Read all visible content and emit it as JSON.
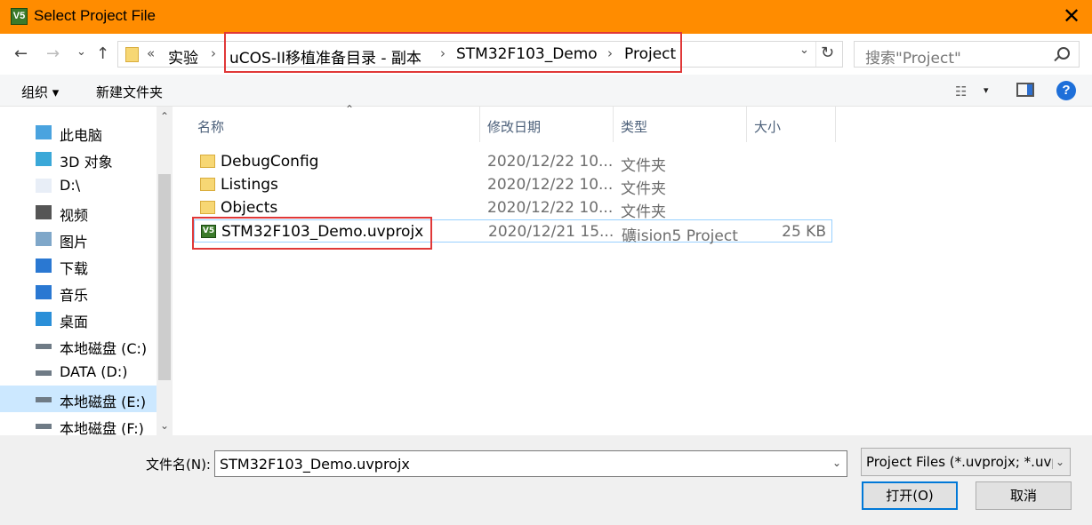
{
  "window": {
    "title": "Select Project File",
    "close_glyph": "✕",
    "app_icon_text": "V5"
  },
  "nav": {
    "back_glyph": "←",
    "forward_glyph": "→",
    "recent_glyph": "⌄",
    "up_glyph": "↑",
    "overflow_glyph": "«",
    "breadcrumbs": [
      "实验",
      "uCOS-II移植准备目录 - 副本",
      "STM32F103_Demo",
      "Project"
    ],
    "sep_glyph": "›",
    "dropdown_glyph": "⌄",
    "refresh_glyph": "↻",
    "search_placeholder": "搜索\"Project\""
  },
  "toolbar": {
    "organize_label": "组织 ▾",
    "new_folder_label": "新建文件夹",
    "view_glyph": "☷",
    "view_drop_glyph": "▾",
    "help_glyph": "?"
  },
  "sidebar": {
    "items": [
      {
        "label": "此电脑",
        "icon": "computer-icon",
        "color": "#4aa3df"
      },
      {
        "label": "3D 对象",
        "icon": "cube-icon",
        "color": "#3aa8d8"
      },
      {
        "label": "D:\\",
        "icon": "document-icon",
        "color": "#e8eef7"
      },
      {
        "label": "视频",
        "icon": "film-icon",
        "color": "#555555"
      },
      {
        "label": "图片",
        "icon": "picture-icon",
        "color": "#7fa7c9"
      },
      {
        "label": "下载",
        "icon": "download-icon",
        "color": "#2a78d2"
      },
      {
        "label": "音乐",
        "icon": "music-icon",
        "color": "#2a78d2"
      },
      {
        "label": "桌面",
        "icon": "desktop-icon",
        "color": "#2a8fd8"
      },
      {
        "label": "本地磁盘 (C:)",
        "icon": "drive-c-icon",
        "color": "#6f7b86"
      },
      {
        "label": "DATA (D:)",
        "icon": "drive-icon",
        "color": "#6f7b86"
      },
      {
        "label": "本地磁盘 (E:)",
        "icon": "drive-icon",
        "color": "#6f7b86",
        "selected": true
      },
      {
        "label": "本地磁盘 (F:)",
        "icon": "drive-icon",
        "color": "#6f7b86"
      }
    ],
    "scroll_up_glyph": "⌃",
    "scroll_down_glyph": "⌄"
  },
  "list": {
    "sort_glyph": "⌃",
    "columns": [
      "名称",
      "修改日期",
      "类型",
      "大小"
    ],
    "rows": [
      {
        "name": "DebugConfig",
        "date": "2020/12/22 10...",
        "type": "文件夹",
        "size": "",
        "kind": "folder"
      },
      {
        "name": "Listings",
        "date": "2020/12/22 10...",
        "type": "文件夹",
        "size": "",
        "kind": "folder"
      },
      {
        "name": "Objects",
        "date": "2020/12/22 10...",
        "type": "文件夹",
        "size": "",
        "kind": "folder"
      },
      {
        "name": "STM32F103_Demo.uvprojx",
        "date": "2020/12/21 15...",
        "type": "礦ision5 Project",
        "size": "25 KB",
        "kind": "uvproj"
      }
    ]
  },
  "footer": {
    "filename_label": "文件名(N):",
    "filename_value": "STM32F103_Demo.uvprojx",
    "filetype_value": "Project Files (*.uvprojx;  *.uvp",
    "dropdown_glyph": "⌄",
    "open_label": "打开(O)",
    "cancel_label": "取消"
  },
  "colors": {
    "titlebar": "#FF8C00",
    "highlight": "#e03838",
    "selected_row": "#cce8ff",
    "accent": "#0078d7"
  }
}
